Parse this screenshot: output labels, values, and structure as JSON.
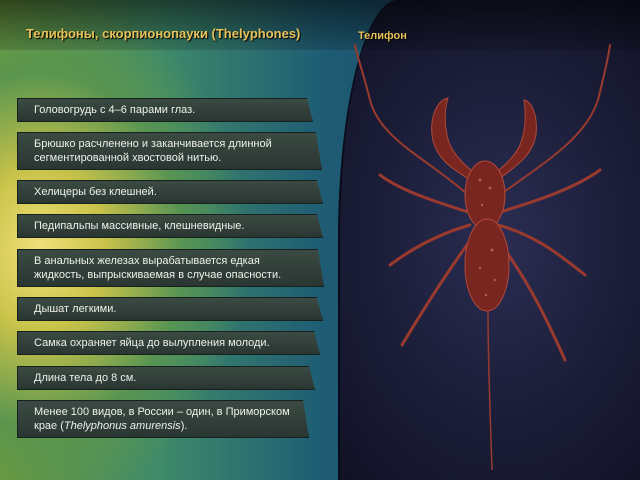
{
  "title": "Телифоны, скорпионопауки (Thelyphones)",
  "image_caption": "Телифон",
  "facts": [
    {
      "text": "Головогрудь с 4–6 парами глаз."
    },
    {
      "text": "Брюшко расчленено и заканчивается длинной сегментированной хвостовой нитью."
    },
    {
      "text": "Хелицеры без клешней."
    },
    {
      "text": "Педипальпы массивные, клешневидные."
    },
    {
      "text": "В анальных железах вырабатывается едкая жидкость, выпрыскиваемая в случае опасности."
    },
    {
      "text": "Дышат легкими."
    },
    {
      "text": "Самка охраняет яйца до вылупления молоди."
    },
    {
      "text": "Длина тела до 8 см."
    },
    {
      "text_before": "Менее 100 видов, в России – один, в Приморском крае (",
      "text_italic": "Thelyphonus amurensis",
      "text_after": ")."
    }
  ],
  "colors": {
    "title": "#e8c25a",
    "panel_text": "#eef2ea",
    "creature": "#8a2a22"
  }
}
